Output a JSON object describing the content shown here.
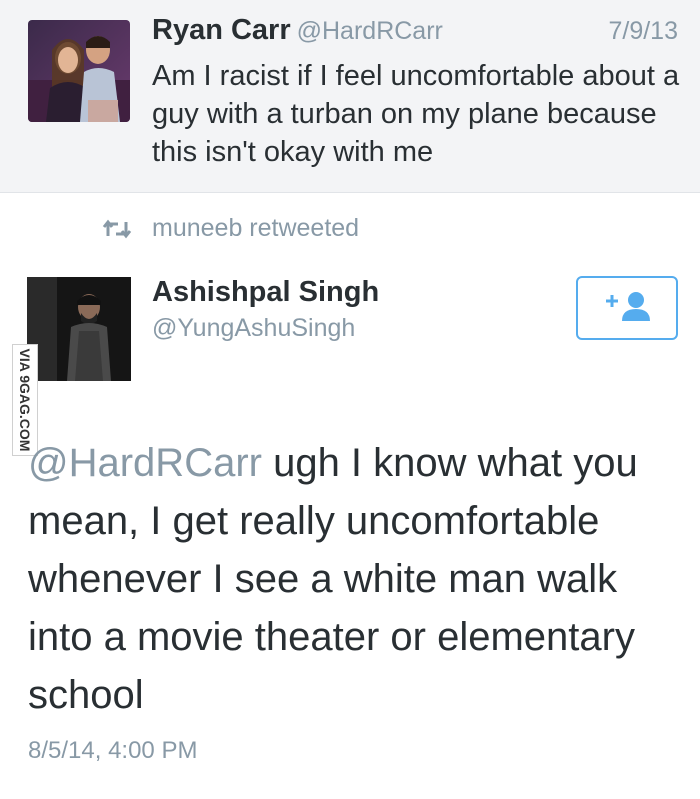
{
  "original_tweet": {
    "name": "Ryan Carr",
    "handle": "@HardRCarr",
    "date": "7/9/13",
    "text": "Am I racist if I feel uncomfortable about a guy with a turban on my plane because this isn't okay with me"
  },
  "retweet": {
    "label": "muneeb retweeted",
    "icon": "retweet-icon"
  },
  "reply_tweet": {
    "name": "Ashishpal Singh",
    "handle": "@YungAshuSingh",
    "mention": "@HardRCarr",
    "text": " ugh I know what you mean, I get really uncomfortable whenever I see a white man walk into a movie theater or elementary school",
    "timestamp": "8/5/14, 4:00 PM",
    "follow_icon": "follow-user-icon"
  },
  "watermark": "VIA 9GAG.COM",
  "colors": {
    "accent": "#55acee",
    "muted": "#8899a6",
    "text": "#292f33",
    "header_bg": "#f3f4f6"
  }
}
